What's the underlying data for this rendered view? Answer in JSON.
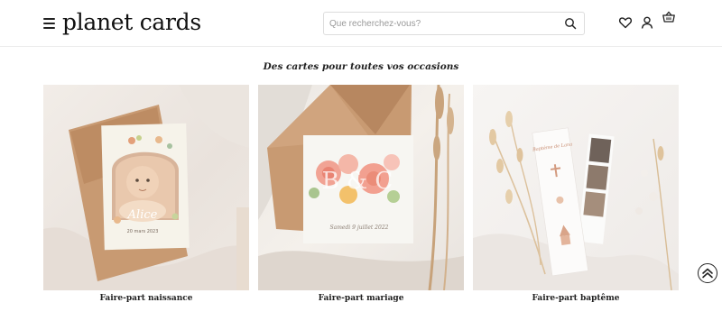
{
  "header": {
    "logo_text": "planet cards",
    "search": {
      "placeholder": "Que recherchez-vous?",
      "value": ""
    },
    "icons": [
      "menu-icon",
      "search-icon",
      "heart-icon",
      "user-icon",
      "basket-icon"
    ]
  },
  "section": {
    "title": "Des cartes pour toutes vos occasions",
    "cards": [
      {
        "label": "Faire-part naissance",
        "image": "birth-announcement-photo"
      },
      {
        "label": "Faire-part mariage",
        "image": "wedding-invitation-photo"
      },
      {
        "label": "Faire-part baptême",
        "image": "baptism-announcement-photo"
      }
    ]
  },
  "decor_text": {
    "birth_name": "Alice",
    "birth_date": "20 mars 2023",
    "wedding_initials": "B & C",
    "wedding_date": "Samedi 9 juillet 2022",
    "baptism_title": "Baptême de Lana"
  },
  "colors": {
    "text": "#1a1a1a",
    "border": "#ececec",
    "kraft": "#c89a72"
  },
  "scroll_top": {
    "icon": "double-chevron-up-icon"
  }
}
